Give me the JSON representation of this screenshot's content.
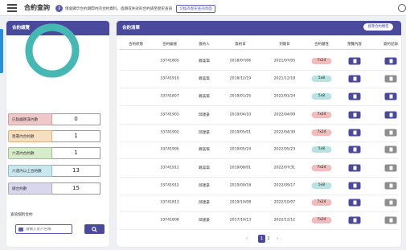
{
  "header": {
    "title": "合約查詢",
    "notice_text": "僅會顯示合約期間內的合約資料，過期或失效的合約請至歷史查詢",
    "notice_button": "切換為歷史查詢頁面"
  },
  "left_panel": {
    "title": "合約總覽",
    "colors": {
      "ring": "#45b8b4",
      "ring_track": "#d8dbe2"
    },
    "stats": [
      {
        "label": "已點綴距滿內數",
        "value": "0",
        "color": "#f0c8c9",
        "border": "#d89a9c"
      },
      {
        "label": "簽署內合約數",
        "value": "1",
        "color": "#f6dfc0",
        "border": "#d8b283"
      },
      {
        "label": "六週內合約數",
        "value": "1",
        "color": "#d7ecc9",
        "border": "#9ec184"
      },
      {
        "label": "六週內以上合約數",
        "value": "13",
        "color": "#c8e7ef",
        "border": "#8ac0cf"
      },
      {
        "label": "總合約數",
        "value": "15",
        "color": "#d9d7ee",
        "border": "#aaa7d3"
      }
    ],
    "search": {
      "label": "查詢個別合約",
      "placeholder": "請輸入客戶名稱",
      "button_icon": "search-icon"
    }
  },
  "right_panel": {
    "title": "合約清單",
    "filter_label": "搜尋合約類型",
    "columns": [
      "合約狀態",
      "合約編號",
      "簽約人",
      "簽約日",
      "到期日",
      "合約屬性",
      "預覽內容",
      "簽約記錄"
    ],
    "rows": [
      {
        "id": "33741805",
        "signer": "鄭美琪",
        "start": "2018/07/06",
        "end": "2021/07/05",
        "type": "7x24",
        "log_active": true
      },
      {
        "id": "33741910",
        "signer": "鄭美琪",
        "start": "2018/12/19",
        "end": "2021/12/18",
        "type": "5x8",
        "log_active": false
      },
      {
        "id": "33741807",
        "signer": "鄭美琪",
        "start": "2019/01/25",
        "end": "2022/01/24",
        "type": "5x8",
        "log_active": true
      },
      {
        "id": "33741903",
        "signer": "邱建豪",
        "start": "2019/04/10",
        "end": "2022/04/09",
        "type": "7x24",
        "log_active": true
      },
      {
        "id": "33741902",
        "signer": "邱建豪",
        "start": "2019/05/01",
        "end": "2022/04/30",
        "type": "7x24",
        "log_active": false
      },
      {
        "id": "33741905",
        "signer": "鄭美琪",
        "start": "2019/05/24",
        "end": "2022/05/23",
        "type": "5x8",
        "log_active": false
      },
      {
        "id": "33741911",
        "signer": "鄭美琪",
        "start": "2019/08/01",
        "end": "2022/07/31",
        "type": "7x24",
        "log_active": false
      },
      {
        "id": "33741912",
        "signer": "邱建豪",
        "start": "2019/09/18",
        "end": "2022/09/17",
        "type": "5x8",
        "log_active": false
      },
      {
        "id": "33741813",
        "signer": "邱建豪",
        "start": "2019/10/08",
        "end": "2022/10/07",
        "type": "7x24",
        "log_active": false
      },
      {
        "id": "33741808",
        "signer": "邱建豪",
        "start": "2017/10/13",
        "end": "2022/12/12",
        "type": "7x24",
        "log_active": false
      }
    ],
    "type_colors": {
      "7x24": "#f1bcbc",
      "5x8": "#b9e3e3"
    },
    "button_colors": {
      "view": "#4a4a9c",
      "log_active": "#4a4a9c",
      "log_inactive": "#8e8e8e"
    },
    "pagination": {
      "prev": "‹",
      "current": "1",
      "next_page": "2",
      "next": "›"
    }
  }
}
